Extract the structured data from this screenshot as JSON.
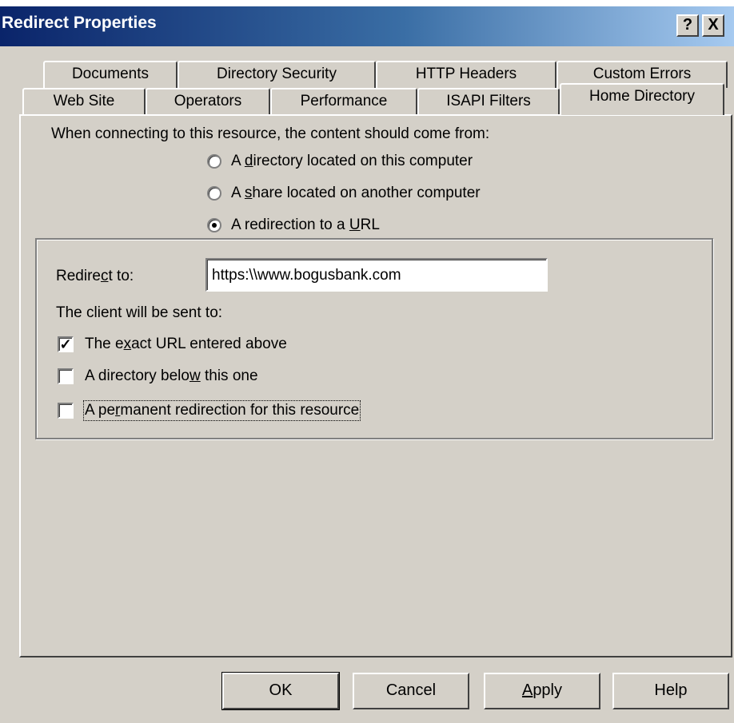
{
  "window": {
    "title": "Redirect Properties",
    "help_button": "?",
    "close_button": "X"
  },
  "tabs": {
    "back_row": [
      "Documents",
      "Directory Security",
      "HTTP Headers",
      "Custom Errors"
    ],
    "front_row": [
      "Web Site",
      "Operators",
      "Performance",
      "ISAPI Filters",
      "Home Directory"
    ],
    "active": "Home Directory"
  },
  "content": {
    "prompt": "When connecting to this resource, the content should come from:",
    "radios": [
      {
        "pre": "A ",
        "key": "d",
        "post": "irectory located on this computer",
        "selected": false
      },
      {
        "pre": "A ",
        "key": "s",
        "post": "hare located on another computer",
        "selected": false
      },
      {
        "pre": "A redirection to a ",
        "key": "U",
        "post": "RL",
        "selected": true
      }
    ]
  },
  "redirect": {
    "label_pre": "Redire",
    "label_key": "c",
    "label_post": "t to:",
    "value": "https:\\\\www.bogusbank.com",
    "client_label": "The client will be sent to:",
    "checkboxes": [
      {
        "pre": "The e",
        "key": "x",
        "post": "act URL entered above",
        "checked": true
      },
      {
        "pre": "A directory belo",
        "key": "w",
        "post": " this one",
        "checked": false
      },
      {
        "pre": "A pe",
        "key": "r",
        "post": "manent redirection for this resource",
        "checked": false
      }
    ]
  },
  "buttons": {
    "ok": "OK",
    "cancel": "Cancel",
    "apply_key": "A",
    "apply_rest": "pply",
    "help": "Help"
  }
}
